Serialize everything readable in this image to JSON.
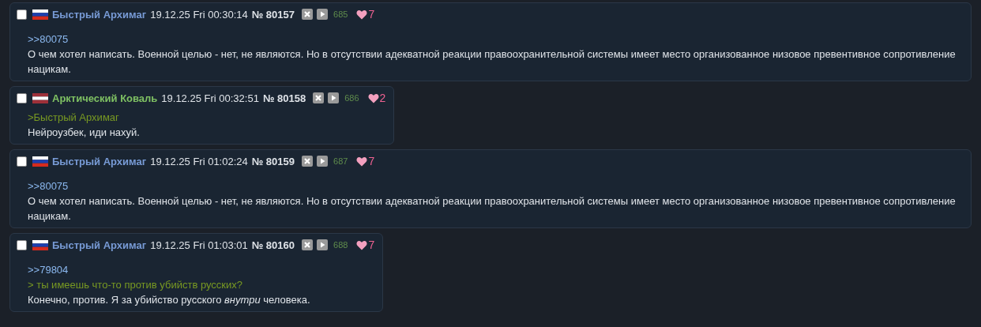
{
  "posts": [
    {
      "checked": false,
      "flag": {
        "kind": "ru"
      },
      "author": {
        "name": "Быстрый Архимаг",
        "color": "#789bd6"
      },
      "date": "19.12.25 Fri 00:30:14",
      "number": "№ 80157",
      "views": "685",
      "likes": "7",
      "body": [
        {
          "kind": "reply_link",
          "text": ">>80075"
        },
        {
          "kind": "text",
          "text": "О чем хотел написать. Военной целью - нет, не являются. Но в отсутствии адекватной реакции правоохранительной системы имеет место организованное низовое превентивное сопротивление нацикам."
        }
      ]
    },
    {
      "checked": false,
      "flag": {
        "kind": "lv"
      },
      "author": {
        "name": "Арктический Коваль",
        "color": "#7fc163"
      },
      "date": "19.12.25 Fri 00:32:51",
      "number": "№ 80158",
      "views": "686",
      "likes": "2",
      "body": [
        {
          "kind": "quote",
          "text": ">Быстрый Архимаг"
        },
        {
          "kind": "text",
          "text": "Нейроузбек, иди нахуй."
        }
      ]
    },
    {
      "checked": false,
      "flag": {
        "kind": "ru"
      },
      "author": {
        "name": "Быстрый Архимаг",
        "color": "#789bd6"
      },
      "date": "19.12.25 Fri 01:02:24",
      "number": "№ 80159",
      "views": "687",
      "likes": "7",
      "body": [
        {
          "kind": "reply_link",
          "text": ">>80075"
        },
        {
          "kind": "text",
          "text": "О чем хотел написать. Военной целью - нет, не являются. Но в отсутствии адекватной реакции правоохранительной системы имеет место организованное низовое превентивное сопротивление нацикам."
        }
      ]
    },
    {
      "checked": false,
      "flag": {
        "kind": "ru"
      },
      "author": {
        "name": "Быстрый Архимаг",
        "color": "#789bd6"
      },
      "date": "19.12.25 Fri 01:03:01",
      "number": "№ 80160",
      "views": "688",
      "likes": "7",
      "body": [
        {
          "kind": "reply_link",
          "text": ">>79804"
        },
        {
          "kind": "quote",
          "text": "> ты имеешь что-то против убийств русских?"
        },
        {
          "kind": "text",
          "text": "Конечно, против. Я за убийство русского *внутри* человека."
        }
      ]
    }
  ]
}
